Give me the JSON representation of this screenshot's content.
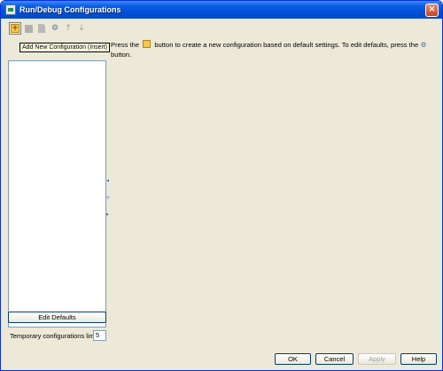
{
  "window": {
    "title": "Run/Debug Configurations",
    "close_glyph": "×"
  },
  "toolbar": {
    "icons": [
      "add-icon",
      "remove-icon",
      "copy-icon",
      "edit-defaults-icon",
      "move-up-icon",
      "move-down-icon"
    ],
    "add_glyph": "+",
    "wrench_glyph": "⚙",
    "up_glyph": "↑",
    "down_glyph": "↓"
  },
  "tooltip": {
    "text": "Add New Configuration (Insert)"
  },
  "message": {
    "part1": "Press the",
    "part2": "button to create a new configuration based on default settings.  To edit defaults, press the",
    "part3": "button.",
    "wrench_glyph": "⚙"
  },
  "splitter": {
    "glyphs": [
      "◂",
      "«",
      "▸"
    ]
  },
  "edit_defaults": {
    "label": "Edit Defaults"
  },
  "temp_limit": {
    "label": "Temporary configurations limit:",
    "value": "5"
  },
  "footer": {
    "ok": "OK",
    "cancel": "Cancel",
    "apply": "Apply",
    "help": "Help"
  },
  "colors": {
    "title_bar": "#0052d6",
    "dialog_bg": "#ece9d8",
    "tooltip_bg": "#ffffe1",
    "add_icon": "#f2c94c"
  }
}
